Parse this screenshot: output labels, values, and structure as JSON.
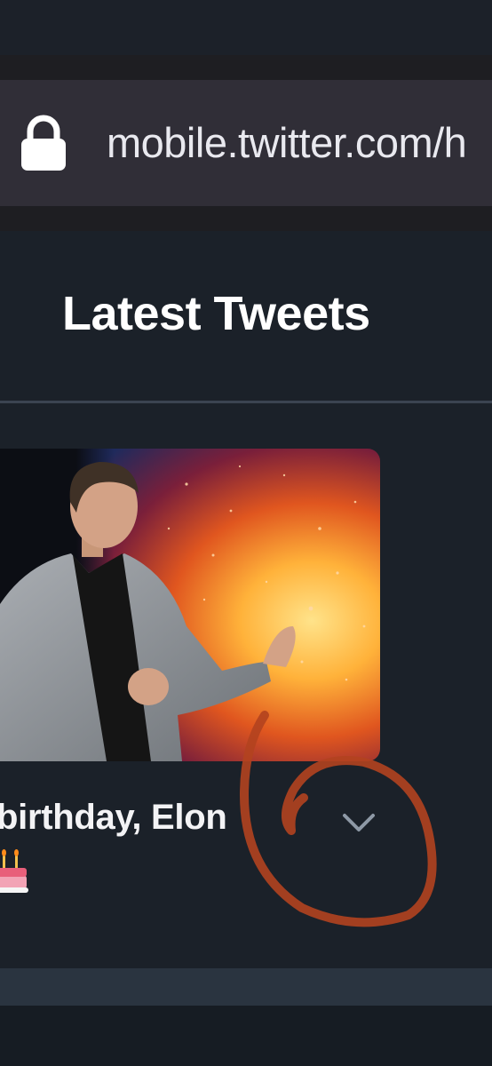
{
  "browser": {
    "url_text": "mobile.twitter.com/h",
    "lock_icon": "lock-icon"
  },
  "header": {
    "title": "Latest Tweets"
  },
  "tweet": {
    "text_line": "birthday, Elon",
    "emoji": "birthday-cake",
    "image": "photo of a man in a grey suit speaking on stage against a fiery space background",
    "menu_icon": "chevron-down-icon"
  },
  "colors": {
    "background": "#1b2129",
    "url_bar": "#302e37",
    "divider": "#3b4451",
    "annotation": "#b3421f"
  }
}
